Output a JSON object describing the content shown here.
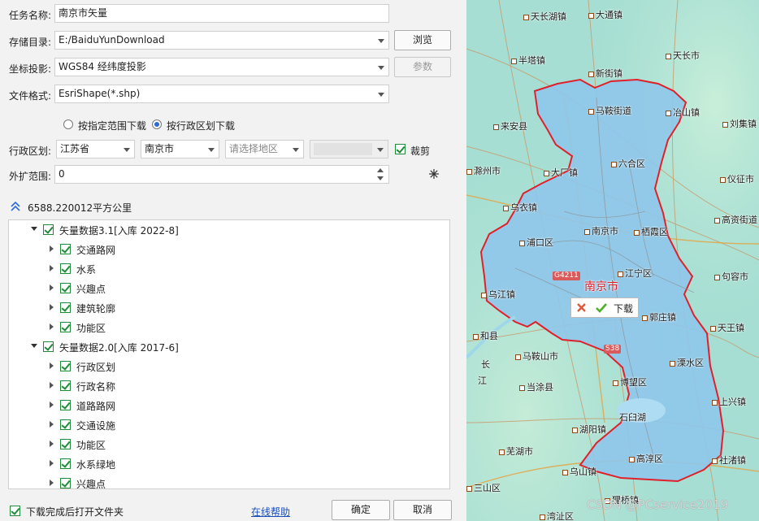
{
  "form": {
    "task_name_label": "任务名称:",
    "task_name_value": "南京市矢量",
    "save_dir_label": "存储目录:",
    "save_dir_value": "E:/BaiduYunDownload",
    "browse_label": "浏览",
    "projection_label": "坐标投影:",
    "projection_value": "WGS84 经纬度投影",
    "params_label": "参数",
    "format_label": "文件格式:",
    "format_value": "EsriShape(*.shp)",
    "mode_range_label": "按指定范围下载",
    "mode_admin_label": "按行政区划下载",
    "admin_label": "行政区划:",
    "province_value": "江苏省",
    "city_value": "南京市",
    "district_placeholder": "请选择地区",
    "clip_label": "裁剪",
    "expand_label": "外扩范围:",
    "expand_value": "0",
    "area_text": "6588.220012平方公里"
  },
  "tree": [
    {
      "label": "矢量数据3.1[入库 2022-8]",
      "level": 0
    },
    {
      "label": "交通路网",
      "level": 1
    },
    {
      "label": "水系",
      "level": 1
    },
    {
      "label": "兴趣点",
      "level": 1
    },
    {
      "label": "建筑轮廓",
      "level": 1
    },
    {
      "label": "功能区",
      "level": 1
    },
    {
      "label": "矢量数据2.0[入库 2017-6]",
      "level": 0
    },
    {
      "label": "行政区划",
      "level": 1
    },
    {
      "label": "行政名称",
      "level": 1
    },
    {
      "label": "道路路网",
      "level": 1
    },
    {
      "label": "交通设施",
      "level": 1
    },
    {
      "label": "功能区",
      "level": 1
    },
    {
      "label": "水系绿地",
      "level": 1
    },
    {
      "label": "兴趣点",
      "level": 1
    }
  ],
  "footer": {
    "open_folder_label": "下载完成后打开文件夹",
    "help_label": "在线帮助",
    "ok_label": "确定",
    "cancel_label": "取消"
  },
  "map": {
    "city_name": "南京市",
    "download_label": "下载",
    "credit": "CSDN @PCservice2019",
    "places": [
      {
        "name": "天长湖镇"
      },
      {
        "name": "大通镇"
      },
      {
        "name": "半塔镇"
      },
      {
        "name": "天长市"
      },
      {
        "name": "新街镇"
      },
      {
        "name": "马鞍街道"
      },
      {
        "name": "冶山镇"
      },
      {
        "name": "来安县"
      },
      {
        "name": "刘集镇"
      },
      {
        "name": "滁州市"
      },
      {
        "name": "六合区"
      },
      {
        "name": "大厂镇"
      },
      {
        "name": "仪征市"
      },
      {
        "name": "乌衣镇"
      },
      {
        "name": "高资街道"
      },
      {
        "name": "南京市"
      },
      {
        "name": "栖霞区"
      },
      {
        "name": "浦口区"
      },
      {
        "name": "江宁区"
      },
      {
        "name": "句容市"
      },
      {
        "name": "乌江镇"
      },
      {
        "name": "郭庄镇"
      },
      {
        "name": "和县"
      },
      {
        "name": "天王镇"
      },
      {
        "name": "马鞍山市"
      },
      {
        "name": "溧水区"
      },
      {
        "name": "当涂县"
      },
      {
        "name": "博望区"
      },
      {
        "name": "上兴镇"
      },
      {
        "name": "湖阳镇"
      },
      {
        "name": "石臼湖"
      },
      {
        "name": "芜湖市"
      },
      {
        "name": "高淳区"
      },
      {
        "name": "社渚镇"
      },
      {
        "name": "乌山镇"
      },
      {
        "name": "三山区"
      },
      {
        "name": "狸桥镇"
      },
      {
        "name": "湾沚区"
      },
      {
        "name": "长"
      },
      {
        "name": "江"
      }
    ],
    "roads": [
      "G4211",
      "S38"
    ]
  },
  "colors": {
    "boundary": "#e0202a",
    "region_fill": "#8fc6ea",
    "map_bg": "#a6ded3",
    "check_green": "#1f8a3a",
    "link": "#1a4fb8"
  }
}
